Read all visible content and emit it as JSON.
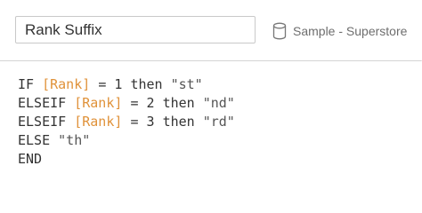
{
  "calc": {
    "name": "Rank Suffix",
    "datasource": "Sample - Superstore",
    "datasource_icon": "database-icon"
  },
  "colors": {
    "field": "#e0923a",
    "text": "#333333",
    "border": "#c9c9c9"
  },
  "formula": {
    "lines": [
      [
        {
          "t": "IF",
          "k": "keyword"
        },
        {
          "t": " ",
          "k": "space"
        },
        {
          "t": "[Rank]",
          "k": "field"
        },
        {
          "t": " ",
          "k": "space"
        },
        {
          "t": "=",
          "k": "op"
        },
        {
          "t": " ",
          "k": "space"
        },
        {
          "t": "1",
          "k": "num"
        },
        {
          "t": " ",
          "k": "space"
        },
        {
          "t": "then",
          "k": "keyword"
        },
        {
          "t": " ",
          "k": "space"
        },
        {
          "t": "\"st\"",
          "k": "string"
        }
      ],
      [
        {
          "t": "ELSEIF",
          "k": "keyword"
        },
        {
          "t": " ",
          "k": "space"
        },
        {
          "t": "[Rank]",
          "k": "field"
        },
        {
          "t": " ",
          "k": "space"
        },
        {
          "t": "=",
          "k": "op"
        },
        {
          "t": " ",
          "k": "space"
        },
        {
          "t": "2",
          "k": "num"
        },
        {
          "t": " ",
          "k": "space"
        },
        {
          "t": "then",
          "k": "keyword"
        },
        {
          "t": " ",
          "k": "space"
        },
        {
          "t": "\"nd\"",
          "k": "string"
        }
      ],
      [
        {
          "t": "ELSEIF",
          "k": "keyword"
        },
        {
          "t": " ",
          "k": "space"
        },
        {
          "t": "[Rank]",
          "k": "field"
        },
        {
          "t": " ",
          "k": "space"
        },
        {
          "t": "=",
          "k": "op"
        },
        {
          "t": " ",
          "k": "space"
        },
        {
          "t": "3",
          "k": "num"
        },
        {
          "t": " ",
          "k": "space"
        },
        {
          "t": "then",
          "k": "keyword"
        },
        {
          "t": " ",
          "k": "space"
        },
        {
          "t": "\"rd\"",
          "k": "string"
        }
      ],
      [
        {
          "t": "ELSE",
          "k": "keyword"
        },
        {
          "t": " ",
          "k": "space"
        },
        {
          "t": "\"th\"",
          "k": "string"
        }
      ],
      [
        {
          "t": "END",
          "k": "keyword"
        }
      ]
    ]
  }
}
